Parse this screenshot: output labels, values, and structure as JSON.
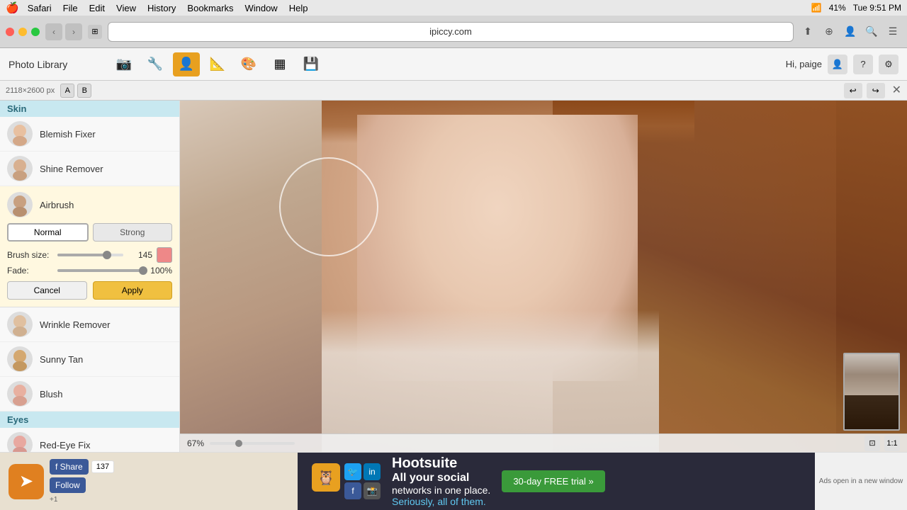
{
  "menubar": {
    "apple": "🍎",
    "app": "Safari",
    "menus": [
      "File",
      "Edit",
      "View",
      "History",
      "Bookmarks",
      "Window",
      "Help"
    ],
    "battery": "41%",
    "time": "Tue 9:51 PM"
  },
  "browser": {
    "url": "ipiccy.com",
    "back": "‹",
    "forward": "›"
  },
  "toolbar": {
    "title": "Photo Library",
    "tools": [
      "📷",
      "🔧",
      "👤",
      "📐",
      "🎨",
      "📦",
      "💾"
    ],
    "active_tool_index": 2,
    "hi_label": "Hi, paige"
  },
  "subtoolbar": {
    "pixel_info": "2118×2600 px",
    "text_a": "A",
    "text_b": "B"
  },
  "sidebar": {
    "skin_label": "Skin",
    "eyes_label": "Eyes",
    "items_skin": [
      {
        "label": "Blemish Fixer",
        "id": "blemish-fixer"
      },
      {
        "label": "Shine Remover",
        "id": "shine-remover"
      },
      {
        "label": "Airbrush",
        "id": "airbrush",
        "active": true
      },
      {
        "label": "Wrinkle Remover",
        "id": "wrinkle-remover"
      },
      {
        "label": "Sunny Tan",
        "id": "sunny-tan"
      },
      {
        "label": "Blush",
        "id": "blush"
      }
    ],
    "items_eyes": [
      {
        "label": "Red-Eye Fix",
        "id": "red-eye-fix"
      }
    ]
  },
  "airbrush_panel": {
    "normal_label": "Normal",
    "strong_label": "Strong",
    "brush_size_label": "Brush size:",
    "brush_size_value": "145",
    "fade_label": "Fade:",
    "fade_value": "100%",
    "cancel_label": "Cancel",
    "apply_label": "Apply"
  },
  "canvas": {
    "zoom_percent": "67%",
    "zoom_label": "1:1"
  },
  "ad": {
    "share_label": "Share",
    "share_count": "137",
    "follow_label": "Follow",
    "hootsuite": "Hootsuite",
    "tagline_line1": "All your social",
    "tagline_line2": "networks in one place.",
    "tagline_line3": "Seriously, all of them.",
    "cta": "30-day FREE trial »",
    "ads_note": "Ads open in a new window"
  }
}
